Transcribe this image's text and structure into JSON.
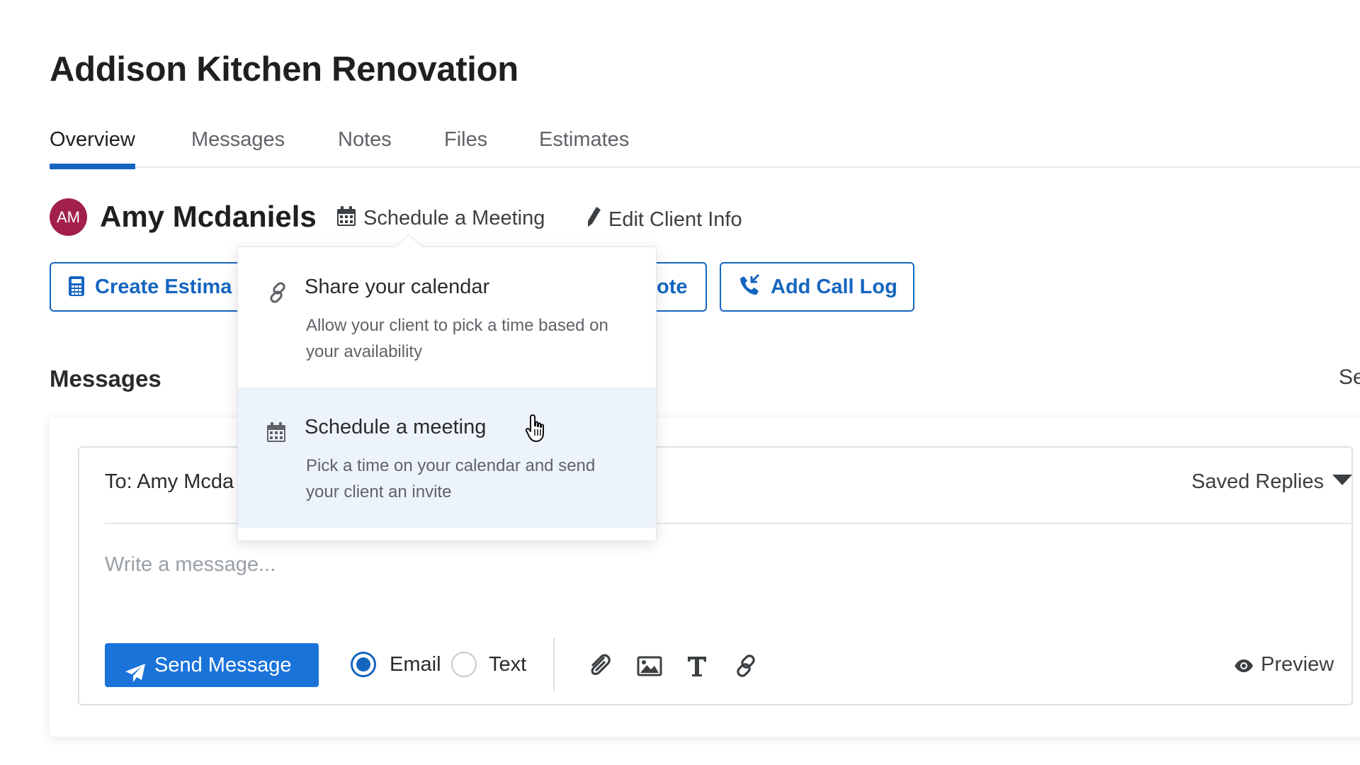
{
  "page": {
    "title": "Addison Kitchen Renovation"
  },
  "tabs": [
    {
      "label": "Overview",
      "active": true
    },
    {
      "label": "Messages",
      "active": false
    },
    {
      "label": "Notes",
      "active": false
    },
    {
      "label": "Files",
      "active": false
    },
    {
      "label": "Estimates",
      "active": false
    }
  ],
  "client": {
    "initials": "AM",
    "name": "Amy Mcdaniels",
    "avatar_color": "#a3204e",
    "schedule_label": "Schedule a Meeting",
    "schedule_icon": "calendar-icon",
    "edit_label": "Edit Client Info",
    "edit_icon": "pencil-icon"
  },
  "actions": {
    "create_estimate_label": "Create Estima",
    "create_estimate_icon": "calculator-icon",
    "note_label": "ote",
    "call_log_label": "Add Call Log",
    "call_log_icon": "phone-call-icon"
  },
  "messages": {
    "section_title": "Messages",
    "section_right": "Se",
    "to_label": "To: Amy Mcda",
    "saved_replies_label": "Saved Replies",
    "input_placeholder": "Write a message...",
    "send_label": "Send Message",
    "channels": [
      {
        "label": "Email",
        "selected": true
      },
      {
        "label": "Text",
        "selected": false
      }
    ],
    "toolbar_icons": [
      "paperclip-icon",
      "image-icon",
      "text-format-icon",
      "link-icon"
    ],
    "preview_label": "Preview"
  },
  "dropdown": {
    "items": [
      {
        "title": "Share your calendar",
        "description": "Allow your client to pick a time based on your availability",
        "icon": "link-icon",
        "hovered": false
      },
      {
        "title": "Schedule a meeting",
        "description": "Pick a time on your calendar and send your client an invite",
        "icon": "calendar-icon",
        "hovered": true
      }
    ]
  },
  "colors": {
    "accent": "#1565c0",
    "send_button": "#1a73d9",
    "hover_background": "#edf3fb"
  }
}
